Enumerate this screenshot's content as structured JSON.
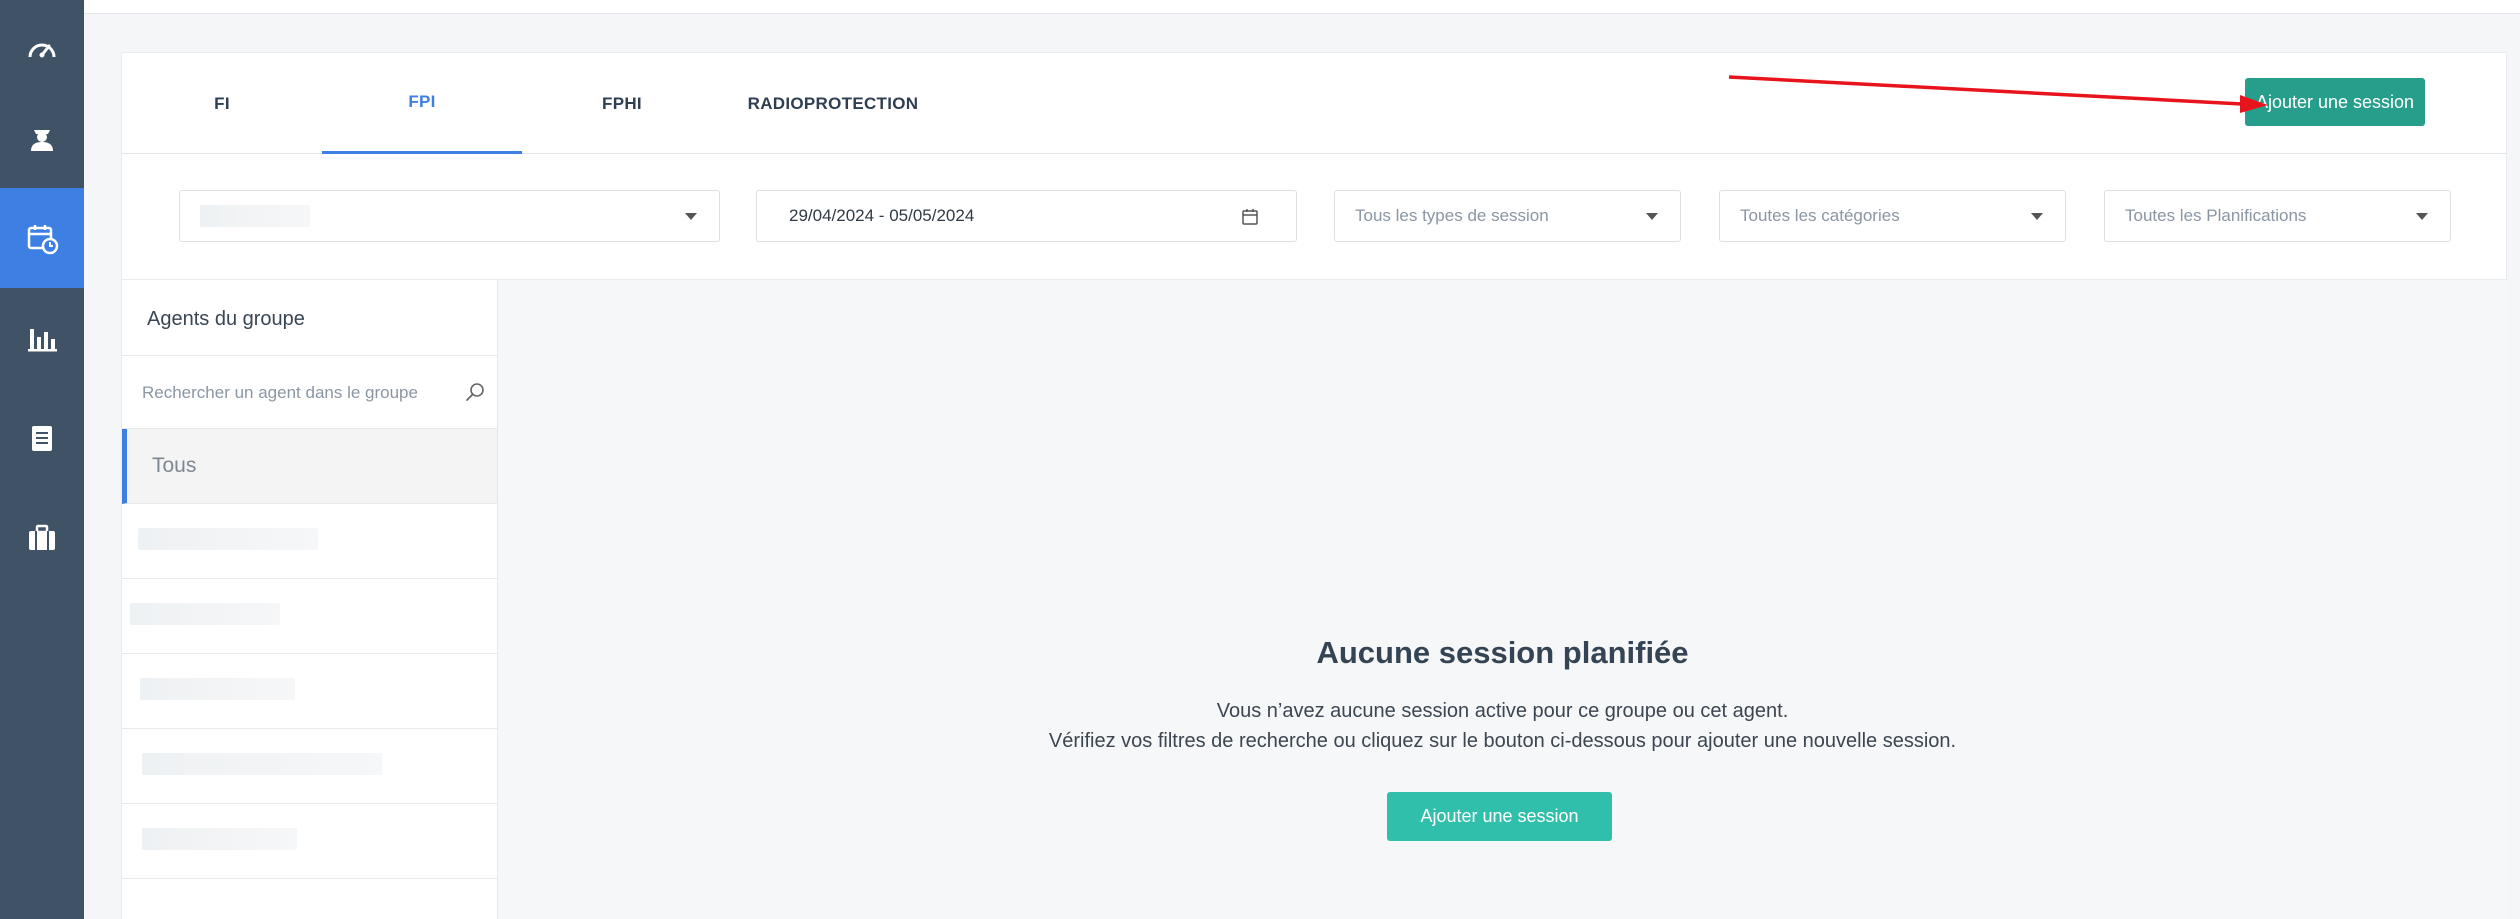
{
  "tabs": [
    {
      "label": "FI"
    },
    {
      "label": "FPI"
    },
    {
      "label": "FPHI"
    },
    {
      "label": "RADIOPROTECTION"
    }
  ],
  "active_tab": "FPI",
  "header": {
    "add_session_label": "Ajouter une session"
  },
  "filters": {
    "date_range": "29/04/2024 - 05/05/2024",
    "session_type_placeholder": "Tous les types de session",
    "category_placeholder": "Toutes les catégories",
    "planification_placeholder": "Toutes les Planifications"
  },
  "agents": {
    "title": "Agents du groupe",
    "search_placeholder": "Rechercher un agent dans le groupe",
    "all_label": "Tous"
  },
  "empty_state": {
    "title": "Aucune session planifiée",
    "line1": "Vous n’avez aucune session active pour ce groupe ou cet agent.",
    "line2": "Vérifiez vos filtres de recherche ou cliquez sur le bouton ci-dessous pour ajouter une nouvelle session.",
    "button_label": "Ajouter une session"
  },
  "colors": {
    "sidebar": "#3f5266",
    "accent": "#3e7fe3",
    "primary_button": "#279e8b",
    "empty_button": "#2fbfab",
    "annotation_arrow": "#e8141c"
  },
  "icons": [
    "dashboard-gauge-icon",
    "agent-user-icon",
    "calendar-clock-icon",
    "bar-chart-icon",
    "document-list-icon",
    "briefcase-icon",
    "chevron-down-icon",
    "calendar-icon",
    "search-icon"
  ]
}
